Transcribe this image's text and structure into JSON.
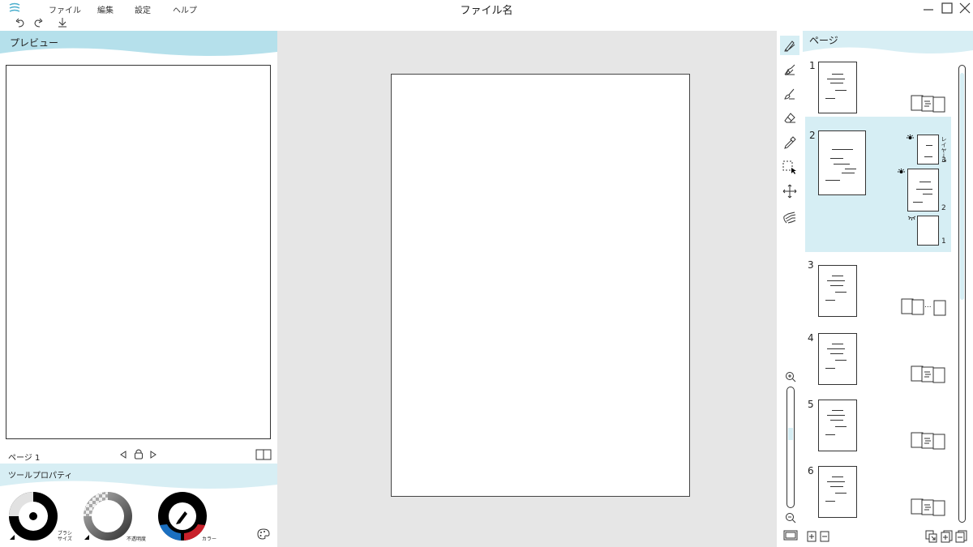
{
  "app": {
    "title": "ファイル名",
    "menu": [
      "ファイル",
      "編集",
      "設定",
      "ヘルプ"
    ]
  },
  "preview": {
    "title": "プレビュー",
    "page_label": "ページ 1"
  },
  "tool_properties": {
    "title": "ツールプロパティ",
    "brush_size_label_1": "ブラシ",
    "brush_size_label_2": "サイズ",
    "opacity_label": "不透明度",
    "color_label": "カラー"
  },
  "tools": [
    "pen-tool-icon",
    "fountain-pen-icon",
    "brush-icon",
    "eraser-icon",
    "eyedropper-icon",
    "selection-icon",
    "move-icon",
    "hand-icon"
  ],
  "page_panel": {
    "title": "ページ",
    "pages": [
      {
        "number": "1"
      },
      {
        "number": "2",
        "selected": true,
        "layers": [
          {
            "label": "レイヤー3",
            "number": "3",
            "visible": true
          },
          {
            "number": "2",
            "visible": true
          },
          {
            "number": "1",
            "visible": false
          }
        ]
      },
      {
        "number": "3",
        "ellipsis": "..."
      },
      {
        "number": "4"
      },
      {
        "number": "5"
      },
      {
        "number": "6"
      }
    ]
  },
  "colors": {
    "header_band": "#b5e0eb",
    "selected_page": "#d6eef4",
    "canvas_bg": "#e6e6e6",
    "color_wheel_blue": "#1a6fc0",
    "color_wheel_red": "#c8202a"
  }
}
